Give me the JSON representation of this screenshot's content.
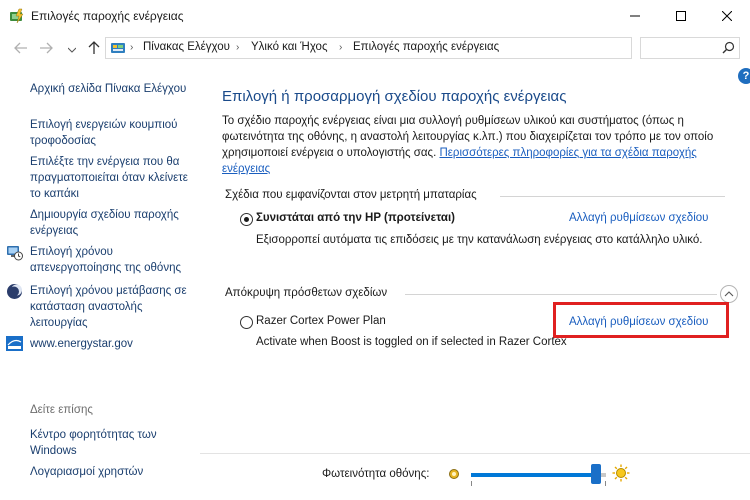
{
  "window": {
    "title": "Επιλογές παροχής ενέργειας"
  },
  "address_bar": {
    "breadcrumbs": [
      "Πίνακας Ελέγχου",
      "Υλικό και Ήχος",
      "Επιλογές παροχής ενέργειας"
    ],
    "search_placeholder": ""
  },
  "sidebar": {
    "home_link": "Αρχική σελίδα Πίνακα Ελέγχου",
    "links": [
      "Επιλογή ενεργειών κουμπιού τροφοδοσίας",
      "Επιλέξτε την ενέργεια που θα πραγματοποιείται όταν κλείνετε το καπάκι",
      "Δημιουργία σχεδίου παροχής ενέργειας",
      "Επιλογή χρόνου απενεργοποίησης της οθόνης",
      "Επιλογή χρόνου μετάβασης σε κατάσταση αναστολής λειτουργίας",
      "www.energystar.gov"
    ],
    "see_also_heading": "Δείτε επίσης",
    "see_also": [
      "Κέντρο φορητότητας των Windows",
      "Λογαριασμοί χρηστών"
    ]
  },
  "main": {
    "title": "Επιλογή ή προσαρμογή σχεδίου παροχής ενέργειας",
    "description": "Το σχέδιο παροχής ενέργειας είναι μια συλλογή ρυθμίσεων υλικού και συστήματος (όπως η φωτεινότητα της οθόνης, η αναστολή λειτουργίας κ.λπ.) που διαχειρίζεται τον τρόπο με τον οποίο χρησιμοποιεί ενέργεια ο υπολογιστής σας.",
    "more_info_link": "Περισσότερες πληροφορίες για τα σχέδια παροχής ενέργειας",
    "battery_group_label": "Σχέδια που εμφανίζονται στον μετρητή μπαταρίας",
    "hidden_group_label": "Απόκρυψη πρόσθετων σχεδίων",
    "plans": [
      {
        "name": "Συνιστάται από την HP (προτείνεται)",
        "description": "Εξισορροπεί αυτόματα τις επιδόσεις με την κατανάλωση ενέργειας στο κατάλληλο υλικό.",
        "change_link": "Αλλαγή ρυθμίσεων σχεδίου",
        "selected": true
      },
      {
        "name": "Razer Cortex Power Plan",
        "description": "Activate when Boost is toggled on if selected in Razer Cortex",
        "change_link": "Αλλαγή ρυθμίσεων σχεδίου",
        "selected": false
      }
    ]
  },
  "brightness": {
    "label": "Φωτεινότητα οθόνης:",
    "level_percent": 95
  },
  "colors": {
    "accent": "#0078d7",
    "title_blue": "#1a4a8a",
    "link_blue": "#1a5ebf",
    "highlight_red": "#e02020"
  }
}
